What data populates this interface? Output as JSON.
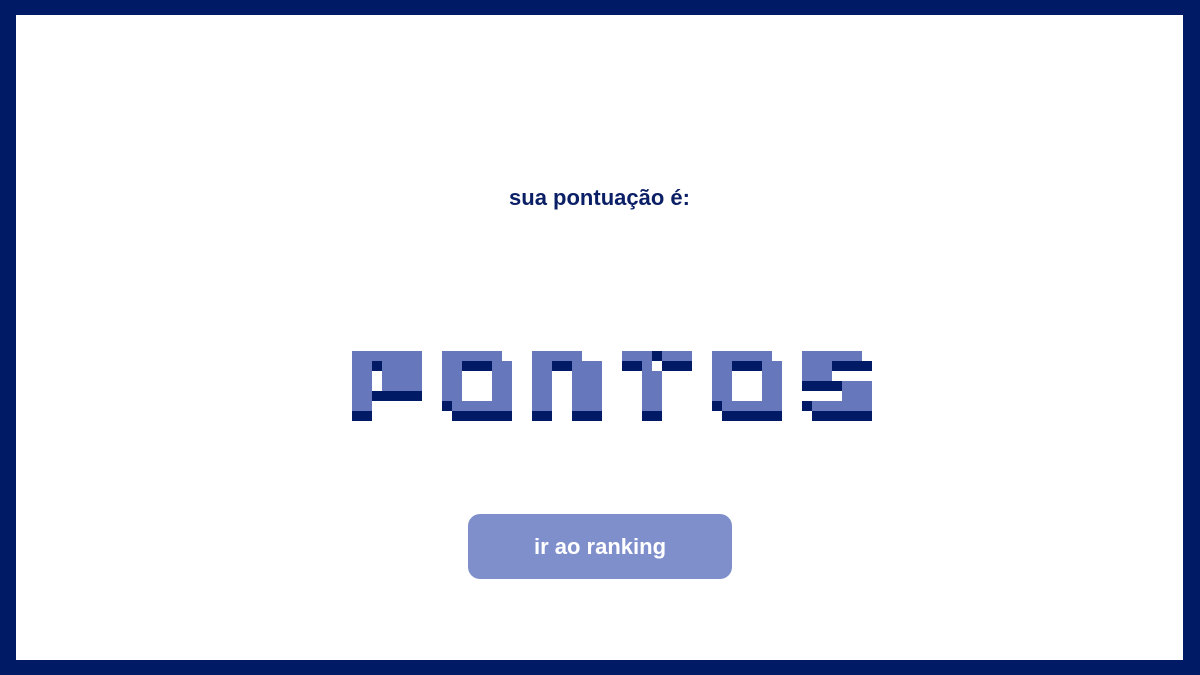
{
  "score": {
    "label": "sua pontuação é:",
    "value": "PONTOS"
  },
  "actions": {
    "ranking_label": "ir ao ranking"
  },
  "colors": {
    "frame": "#001a66",
    "background": "#ffffff",
    "text": "#0b1f66",
    "pixel_fill": "#6677bb",
    "pixel_shadow": "#001a66",
    "button": "#7f8fcc",
    "button_text": "#ffffff"
  }
}
